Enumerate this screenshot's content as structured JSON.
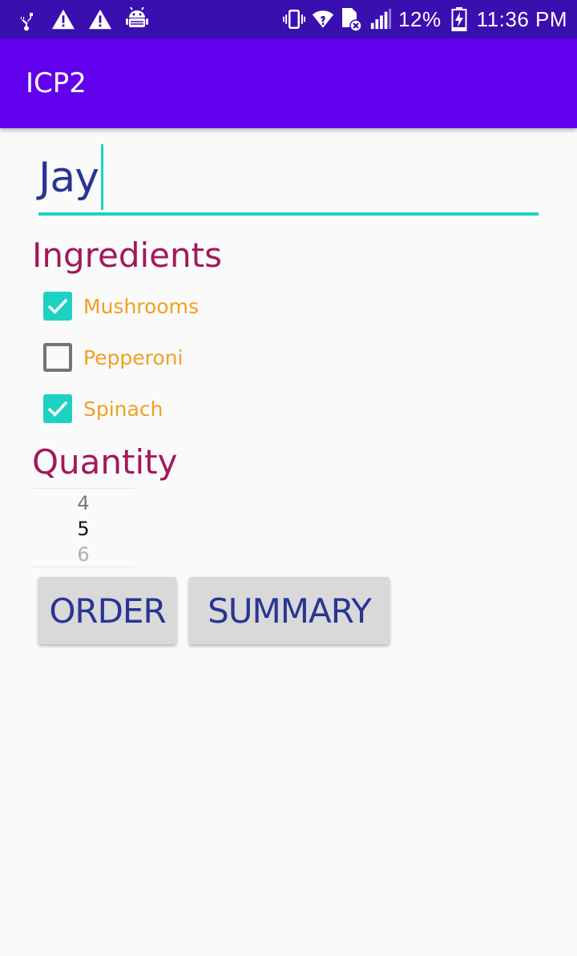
{
  "status_bar": {
    "left_icons": [
      "usb-icon",
      "warning-icon",
      "warning-icon",
      "android-icon"
    ],
    "right_icons": [
      "vibrate-icon",
      "wifi-icon",
      "sim-no-icon",
      "signal-icon",
      "battery-charging-icon"
    ],
    "battery_percent": "12%",
    "time": "11:36 PM",
    "bg_color": "#3a0fb0"
  },
  "app_bar": {
    "title": "ICP2",
    "color": "#6200ee"
  },
  "name_field": {
    "value": "Jay",
    "accent_color": "#1ed2c3"
  },
  "ingredients": {
    "heading": "Ingredients",
    "items": [
      {
        "label": "Mushrooms",
        "checked": true
      },
      {
        "label": "Pepperoni",
        "checked": false
      },
      {
        "label": "Spinach",
        "checked": true
      }
    ]
  },
  "quantity": {
    "heading": "Quantity",
    "previous": "4",
    "selected": "5",
    "next": "6"
  },
  "buttons": {
    "order": "ORDER",
    "summary": "SUMMARY"
  },
  "colors": {
    "heading": "#a3185a",
    "checkbox_label": "#f0a020",
    "button_text": "#283593"
  }
}
